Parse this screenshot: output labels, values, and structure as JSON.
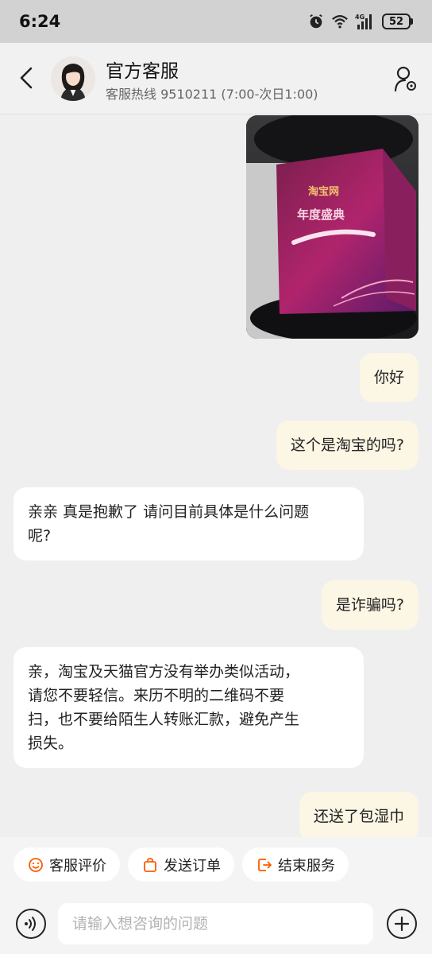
{
  "status_bar": {
    "time": "6:24",
    "battery": "52",
    "network": "4G",
    "icons": [
      "alarm-icon",
      "wifi-icon",
      "signal-icon",
      "battery-icon"
    ]
  },
  "header": {
    "title": "官方客服",
    "subtitle": "客服热线 9510211 (7:00-次日1:00)",
    "back_icon": "chevron-left-icon",
    "settings_icon": "user-settings-icon"
  },
  "messages": [
    {
      "from": "me",
      "type": "image",
      "image_text": [
        "淘宝网",
        "年度盛典"
      ]
    },
    {
      "from": "me",
      "type": "text",
      "text": "你好"
    },
    {
      "from": "me",
      "type": "text",
      "text": "这个是淘宝的吗?"
    },
    {
      "from": "cs",
      "type": "text",
      "lines": [
        "亲亲 真是抱歉了 请问目前具体是什么问题",
        "呢?"
      ]
    },
    {
      "from": "me",
      "type": "text",
      "text": "是诈骗吗?"
    },
    {
      "from": "cs",
      "type": "text",
      "lines": [
        "亲，淘宝及天猫官方没有举办类似活动，",
        "请您不要轻信。来历不明的二维码不要",
        "扫，也不要给陌生人转账汇款，避免产生",
        "损失。"
      ]
    },
    {
      "from": "me",
      "type": "text",
      "text": "还送了包湿巾"
    }
  ],
  "quick_actions": [
    {
      "label": "客服评价",
      "icon": "smile-icon"
    },
    {
      "label": "发送订单",
      "icon": "bag-icon"
    },
    {
      "label": "结束服务",
      "icon": "exit-icon"
    }
  ],
  "input": {
    "placeholder": "请输入想咨询的问题",
    "value": ""
  },
  "colors": {
    "my_bubble": "#fcf6e5",
    "cs_bubble": "#ffffff",
    "accent": "#ff5a00",
    "background": "#efefef"
  }
}
